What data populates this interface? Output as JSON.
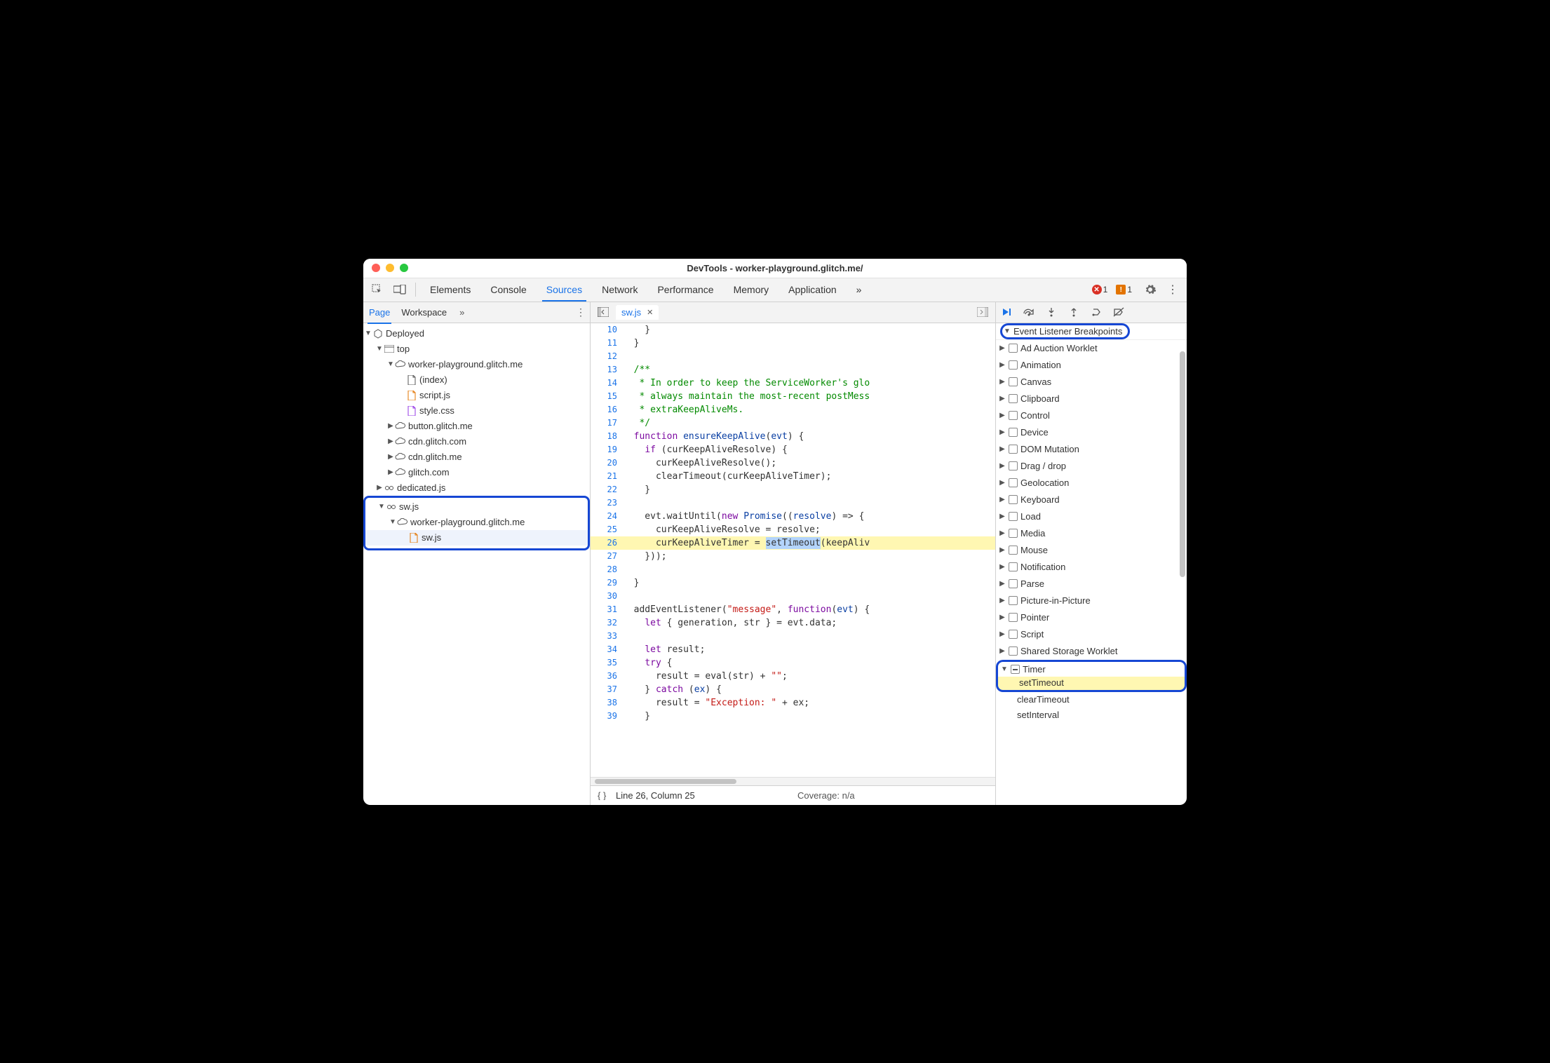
{
  "window_title": "DevTools - worker-playground.glitch.me/",
  "top_tabs": [
    "Elements",
    "Console",
    "Sources",
    "Network",
    "Performance",
    "Memory",
    "Application"
  ],
  "top_tabs_more": "»",
  "active_top_tab": "Sources",
  "errors": {
    "red_count": "1",
    "orange_count": "1"
  },
  "left": {
    "tabs": [
      "Page",
      "Workspace"
    ],
    "active": "Page",
    "more": "»",
    "tree": {
      "root": "Deployed",
      "top": "top",
      "domain1": "worker-playground.glitch.me",
      "files1": [
        "(index)",
        "script.js",
        "style.css"
      ],
      "domains_collapsed": [
        "button.glitch.me",
        "cdn.glitch.com",
        "cdn.glitch.me",
        "glitch.com"
      ],
      "dedicated": "dedicated.js",
      "sw_root": "sw.js",
      "sw_domain": "worker-playground.glitch.me",
      "sw_file": "sw.js"
    }
  },
  "editor": {
    "file_tab": "sw.js",
    "lines": [
      {
        "n": 10,
        "text": "    }"
      },
      {
        "n": 11,
        "text": "  }"
      },
      {
        "n": 12,
        "text": ""
      },
      {
        "n": 13,
        "text": "  /**",
        "cm": true
      },
      {
        "n": 14,
        "text": "   * In order to keep the ServiceWorker's glo",
        "cm": true
      },
      {
        "n": 15,
        "text": "   * always maintain the most-recent postMess",
        "cm": true
      },
      {
        "n": 16,
        "text": "   * extraKeepAliveMs.",
        "cm": true
      },
      {
        "n": 17,
        "text": "   */",
        "cm": true
      },
      {
        "n": 18,
        "html": "  <span class='kw'>function</span> <span class='fn'>ensureKeepAlive</span>(<span class='fn'>evt</span>) {"
      },
      {
        "n": 19,
        "html": "    <span class='kw'>if</span> (curKeepAliveResolve) {"
      },
      {
        "n": 20,
        "text": "      curKeepAliveResolve();"
      },
      {
        "n": 21,
        "text": "      clearTimeout(curKeepAliveTimer);"
      },
      {
        "n": 22,
        "text": "    }"
      },
      {
        "n": 23,
        "text": ""
      },
      {
        "n": 24,
        "html": "    evt.waitUntil(<span class='kw'>new</span> <span class='fn'>Promise</span>((<span class='fn'>resolve</span>) =&gt; {"
      },
      {
        "n": 25,
        "text": "      curKeepAliveResolve = resolve;"
      },
      {
        "n": 26,
        "html": "      curKeepAliveTimer = <span class='sel'>setTimeout</span>(keepAliv",
        "hl": true
      },
      {
        "n": 27,
        "text": "    }));"
      },
      {
        "n": 28,
        "text": ""
      },
      {
        "n": 29,
        "text": "  }"
      },
      {
        "n": 30,
        "text": ""
      },
      {
        "n": 31,
        "html": "  addEventListener(<span class='str'>\"message\"</span>, <span class='kw'>function</span>(<span class='fn'>evt</span>) {"
      },
      {
        "n": 32,
        "html": "    <span class='kw'>let</span> { generation, str } = evt.data;"
      },
      {
        "n": 33,
        "text": ""
      },
      {
        "n": 34,
        "html": "    <span class='kw'>let</span> result;"
      },
      {
        "n": 35,
        "html": "    <span class='kw'>try</span> {"
      },
      {
        "n": 36,
        "html": "      result = eval(str) + <span class='str'>\"\"</span>;"
      },
      {
        "n": 37,
        "html": "    } <span class='kw'>catch</span> (<span class='fn'>ex</span>) {"
      },
      {
        "n": 38,
        "html": "      result = <span class='str'>\"Exception: \"</span> + ex;"
      },
      {
        "n": 39,
        "text": "    }"
      }
    ],
    "status_left": "Line 26, Column 25",
    "status_right": "Coverage: n/a"
  },
  "right": {
    "section": "Event Listener Breakpoints",
    "categories": [
      "Ad Auction Worklet",
      "Animation",
      "Canvas",
      "Clipboard",
      "Control",
      "Device",
      "DOM Mutation",
      "Drag / drop",
      "Geolocation",
      "Keyboard",
      "Load",
      "Media",
      "Mouse",
      "Notification",
      "Parse",
      "Picture-in-Picture",
      "Pointer",
      "Script",
      "Shared Storage Worklet"
    ],
    "timer": {
      "label": "Timer",
      "subs": [
        "setTimeout",
        "clearTimeout",
        "setInterval"
      ],
      "checked": "setTimeout"
    }
  }
}
